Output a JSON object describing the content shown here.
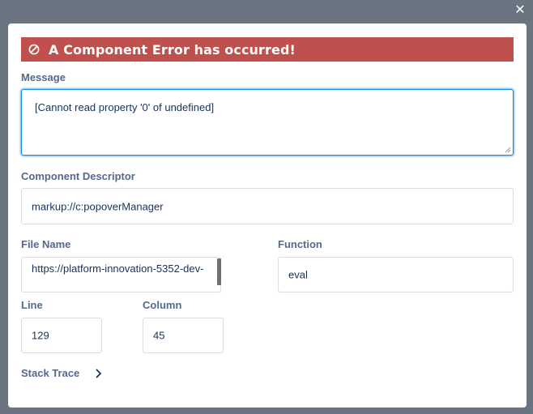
{
  "close_label": "✕",
  "error": {
    "title": "A Component Error has occurred!"
  },
  "message": {
    "label": "Message",
    "value": "[Cannot read property '0' of undefined]"
  },
  "component_descriptor": {
    "label": "Component Descriptor",
    "value": "markup://c:popoverManager"
  },
  "file_name": {
    "label": "File Name",
    "value": "https://platform-innovation-5352-dev-"
  },
  "function": {
    "label": "Function",
    "value": "eval"
  },
  "line": {
    "label": "Line",
    "value": "129"
  },
  "column": {
    "label": "Column",
    "value": "45"
  },
  "stack_trace": {
    "label": "Stack Trace"
  },
  "colors": {
    "overlay": "#6b7481",
    "error_banner": "#c0504d",
    "label_text": "#54698d",
    "value_text": "#16325c",
    "focus_border": "#1589ee"
  },
  "icons": {
    "close": "close-icon",
    "error": "ban-icon",
    "expand": "chevron-right-icon"
  }
}
